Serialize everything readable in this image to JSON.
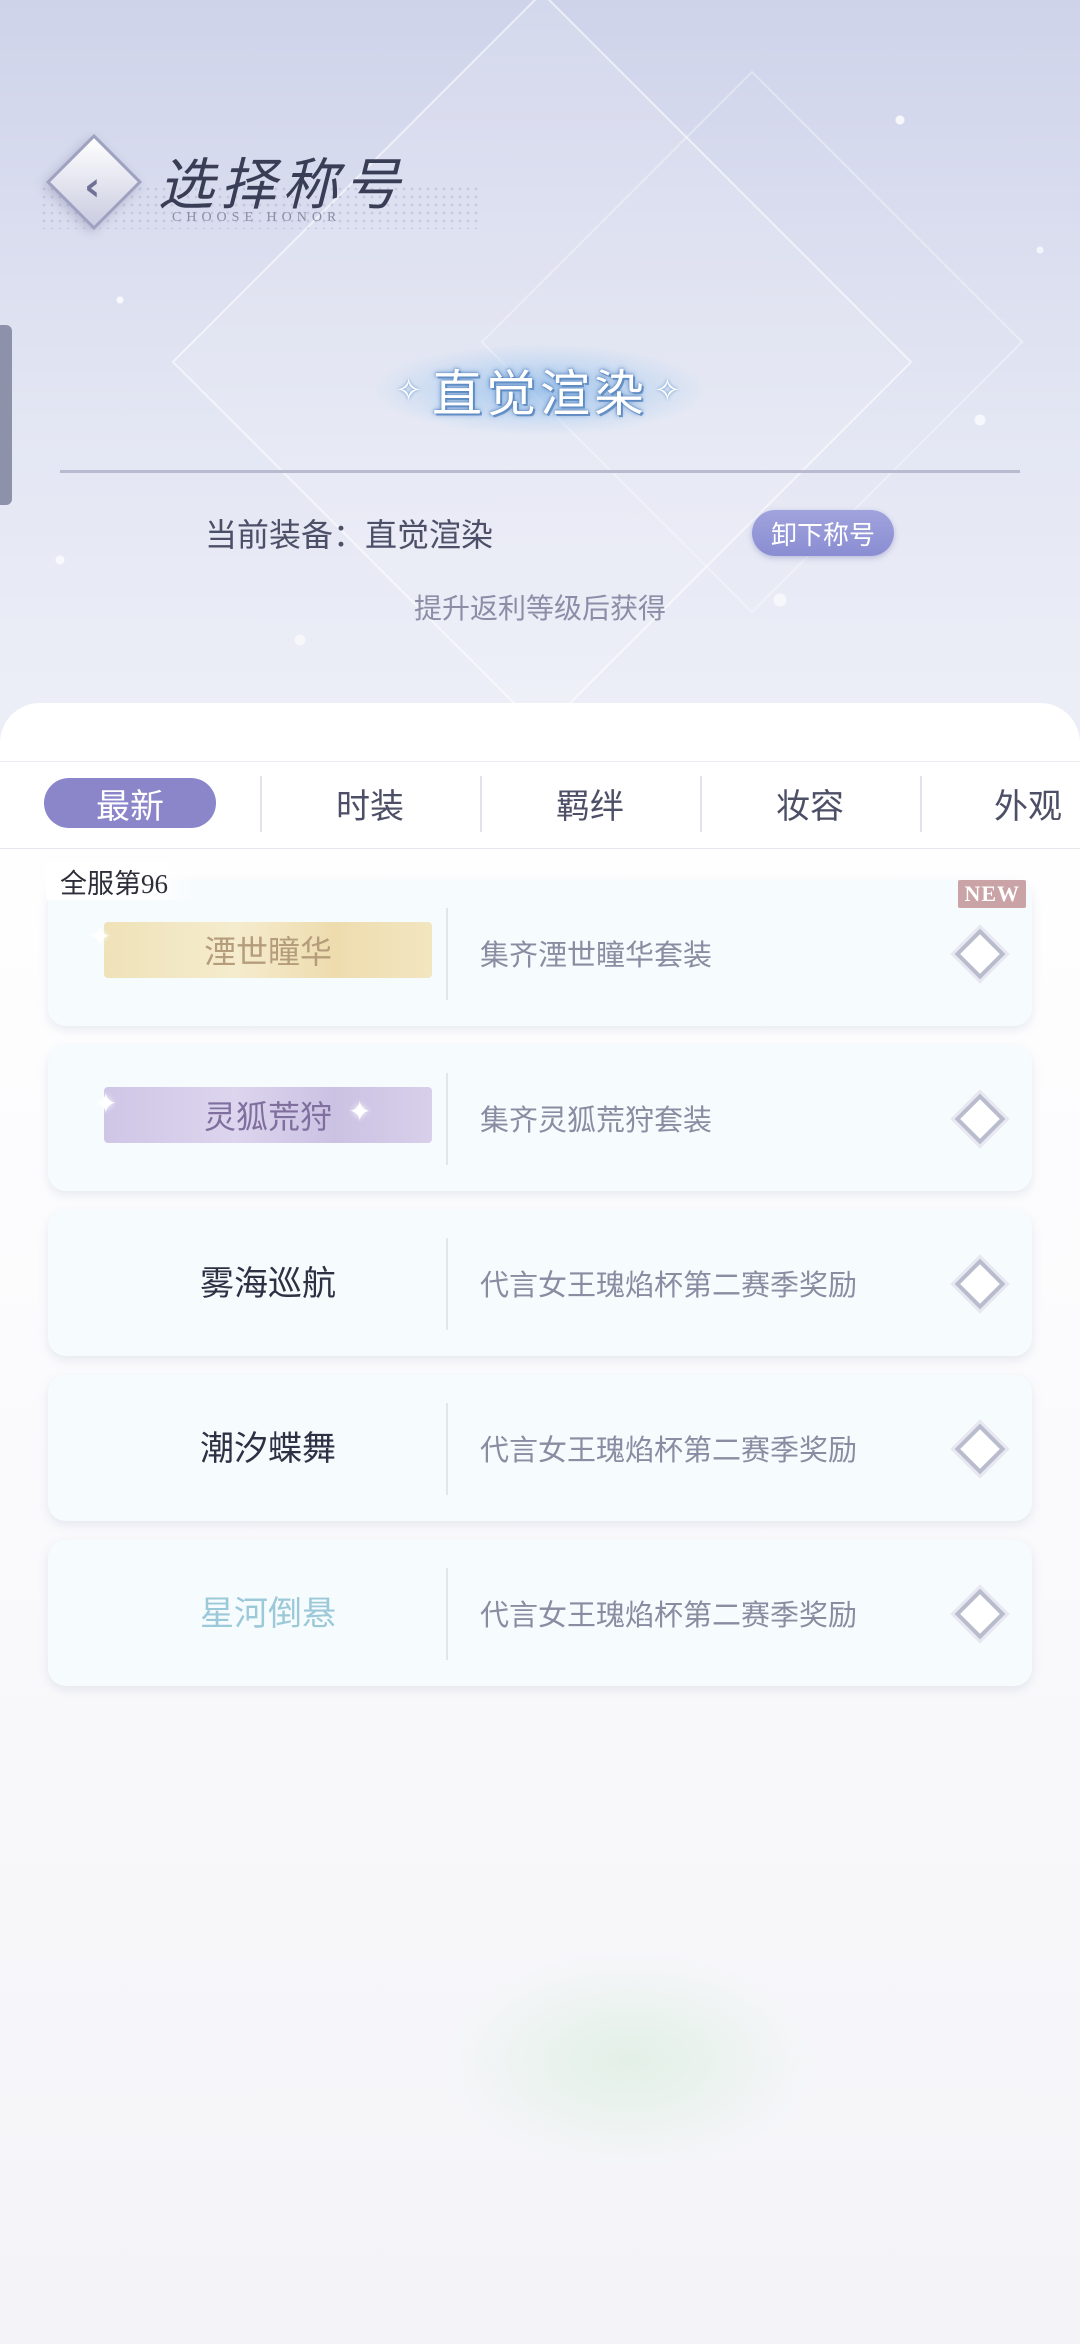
{
  "header": {
    "title": "选择称号",
    "subtitle": "CHOOSE HONOR"
  },
  "current": {
    "badge_text": "直觉渲染",
    "label": "当前装备：",
    "value": "直觉渲染",
    "unequip_label": "卸下称号",
    "hint": "提升返利等级后获得"
  },
  "tabs": [
    {
      "label": "最新",
      "active": true
    },
    {
      "label": "时装",
      "active": false
    },
    {
      "label": "羁绊",
      "active": false
    },
    {
      "label": "妆容",
      "active": false
    },
    {
      "label": "外观",
      "active": false
    }
  ],
  "honors": [
    {
      "name": "湮世瞳华",
      "desc": "集齐湮世瞳华套装",
      "style": "gold",
      "rank_tag": "全服第96",
      "new_tag": "NEW"
    },
    {
      "name": "灵狐荒狩",
      "desc": "集齐灵狐荒狩套装",
      "style": "purple"
    },
    {
      "name": "雾海巡航",
      "desc": "代言女王瑰焰杯第二赛季奖励",
      "style": "plain"
    },
    {
      "name": "潮汐蝶舞",
      "desc": "代言女王瑰焰杯第二赛季奖励",
      "style": "plain"
    },
    {
      "name": "星河倒悬",
      "desc": "代言女王瑰焰杯第二赛季奖励",
      "style": "blue"
    }
  ],
  "icons": {
    "back": "back-chevron-icon",
    "select": "diamond-icon"
  },
  "colors": {
    "accent": "#8a86c9",
    "unequip": "#9497d6"
  }
}
